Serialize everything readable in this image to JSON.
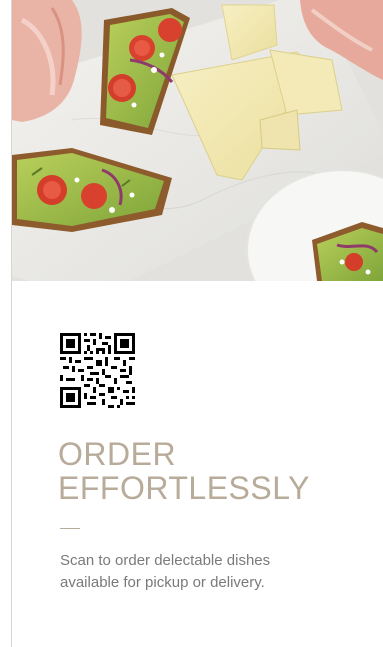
{
  "hero": {
    "image_alt": "Avocado toasts with cherry tomatoes, sliced cheese and prosciutto on a marble board"
  },
  "qr": {
    "icon": "qr-code-icon"
  },
  "headline": {
    "line1": "ORDER",
    "line2": "EFFORTLESSLY"
  },
  "subtext": {
    "line1": "Scan to order delectable dishes",
    "line2": "available for pickup or delivery."
  },
  "colors": {
    "headline": "#b8ab9a",
    "body_text": "#7a7a7a",
    "background": "#ffffff"
  }
}
